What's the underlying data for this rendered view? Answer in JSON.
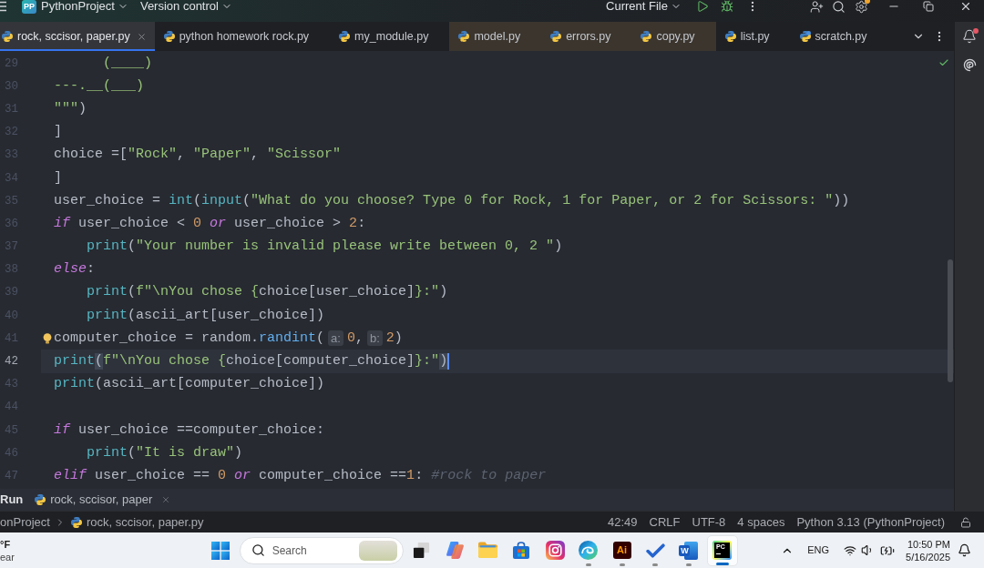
{
  "title_bar": {
    "project_badge": "PP",
    "project": "PythonProject",
    "version_control": "Version control",
    "run_configuration": "Current File",
    "settings_update": true
  },
  "tabs": [
    {
      "label": "rock, sccisor, paper.py",
      "kind": "python",
      "selected": true
    },
    {
      "label": "python homework rock.py",
      "kind": "python",
      "selected": false
    },
    {
      "label": "my_module.py",
      "kind": "python",
      "selected": false
    },
    {
      "label": "model.py",
      "kind": "python",
      "selected": false,
      "color": "#3b352e"
    },
    {
      "label": "errors.py",
      "kind": "python",
      "selected": false,
      "color": "#3b352e"
    },
    {
      "label": "copy.py",
      "kind": "python",
      "selected": false,
      "color": "#3b352e"
    },
    {
      "label": "list.py",
      "kind": "python",
      "selected": false
    },
    {
      "label": "scratch.py",
      "kind": "scratch",
      "selected": false
    }
  ],
  "side_toolbar": {
    "unread_notifications": true
  },
  "editor": {
    "lines": [
      {
        "number": "29",
        "current": false,
        "bulb": false,
        "tokens": [
          {
            "kind": "string",
            "text": "      (____)"
          }
        ]
      },
      {
        "number": "30",
        "current": false,
        "bulb": false,
        "tokens": [
          {
            "kind": "string",
            "text": "---.__(___)"
          }
        ]
      },
      {
        "number": "31",
        "current": false,
        "bulb": false,
        "tokens": [
          {
            "kind": "string",
            "text": "\"\"\""
          },
          {
            "kind": "text",
            "text": ")"
          }
        ]
      },
      {
        "number": "32",
        "current": false,
        "bulb": false,
        "tokens": [
          {
            "kind": "text",
            "text": "]"
          }
        ]
      },
      {
        "number": "33",
        "current": false,
        "bulb": false,
        "tokens": [
          {
            "kind": "text",
            "text": "choice =["
          },
          {
            "kind": "string",
            "text": "\"Rock\""
          },
          {
            "kind": "text",
            "text": ", "
          },
          {
            "kind": "string",
            "text": "\"Paper\""
          },
          {
            "kind": "text",
            "text": ", "
          },
          {
            "kind": "string",
            "text": "\"Scissor\""
          }
        ]
      },
      {
        "number": "34",
        "current": false,
        "bulb": false,
        "tokens": [
          {
            "kind": "text",
            "text": "]"
          }
        ]
      },
      {
        "number": "35",
        "current": false,
        "bulb": false,
        "tokens": [
          {
            "kind": "text",
            "text": "user_choice = "
          },
          {
            "kind": "builtin",
            "text": "int"
          },
          {
            "kind": "text",
            "text": "("
          },
          {
            "kind": "builtin",
            "text": "input"
          },
          {
            "kind": "text",
            "text": "("
          },
          {
            "kind": "string",
            "text": "\"What do you choose? Type 0 for Rock, 1 for Paper, or 2 for Scissors: \""
          },
          {
            "kind": "text",
            "text": "))"
          }
        ]
      },
      {
        "number": "36",
        "current": false,
        "bulb": false,
        "tokens": [
          {
            "kind": "keyword",
            "text": "if"
          },
          {
            "kind": "text",
            "text": " user_choice < "
          },
          {
            "kind": "number",
            "text": "0"
          },
          {
            "kind": "keyword",
            "text": " or"
          },
          {
            "kind": "text",
            "text": " user_choice > "
          },
          {
            "kind": "number",
            "text": "2"
          },
          {
            "kind": "text",
            "text": ":"
          }
        ]
      },
      {
        "number": "37",
        "current": false,
        "bulb": false,
        "tokens": [
          {
            "kind": "builtin",
            "text": "    print"
          },
          {
            "kind": "text",
            "text": "("
          },
          {
            "kind": "string",
            "text": "\"Your number is invalid please write between 0, 2 \""
          },
          {
            "kind": "text",
            "text": ")"
          }
        ]
      },
      {
        "number": "38",
        "current": false,
        "bulb": false,
        "tokens": [
          {
            "kind": "keyword",
            "text": "else"
          },
          {
            "kind": "text",
            "text": ":"
          }
        ]
      },
      {
        "number": "39",
        "current": false,
        "bulb": false,
        "tokens": [
          {
            "kind": "builtin",
            "text": "    print"
          },
          {
            "kind": "text",
            "text": "("
          },
          {
            "kind": "string",
            "text": "f\"\\nYou chose {"
          },
          {
            "kind": "text",
            "text": "choice[user_choice]"
          },
          {
            "kind": "string",
            "text": "}:\""
          },
          {
            "kind": "text",
            "text": ")"
          }
        ]
      },
      {
        "number": "40",
        "current": false,
        "bulb": false,
        "tokens": [
          {
            "kind": "builtin",
            "text": "    print"
          },
          {
            "kind": "text",
            "text": "(ascii_art[user_choice])"
          }
        ]
      },
      {
        "number": "41",
        "current": false,
        "bulb": true,
        "tokens": [
          {
            "kind": "text",
            "text": "computer_choice = random."
          },
          {
            "kind": "method",
            "text": "randint"
          },
          {
            "kind": "text",
            "text": "("
          },
          {
            "kind": "hint",
            "text": "a:"
          },
          {
            "kind": "number",
            "text": "0"
          },
          {
            "kind": "text",
            "text": ","
          },
          {
            "kind": "hint",
            "text": "b:"
          },
          {
            "kind": "number",
            "text": "2"
          },
          {
            "kind": "text",
            "text": ")"
          }
        ]
      },
      {
        "number": "42",
        "current": true,
        "bulb": false,
        "tokens": [
          {
            "kind": "builtin",
            "text": "print"
          },
          {
            "kind": "brace_match",
            "text": "("
          },
          {
            "kind": "string",
            "text": "f\"\\nYou chose {"
          },
          {
            "kind": "text",
            "text": "choice[computer_choice]"
          },
          {
            "kind": "string",
            "text": "}:\""
          },
          {
            "kind": "brace_match",
            "text": ")"
          }
        ]
      },
      {
        "number": "43",
        "current": false,
        "bulb": false,
        "tokens": [
          {
            "kind": "builtin",
            "text": "print"
          },
          {
            "kind": "text",
            "text": "(ascii_art[computer_choice])"
          }
        ]
      },
      {
        "number": "44",
        "current": false,
        "bulb": false
      },
      {
        "number": "45",
        "current": false,
        "bulb": false,
        "tokens": [
          {
            "kind": "keyword",
            "text": "if"
          },
          {
            "kind": "text",
            "text": " user_choice ==computer_choice:"
          }
        ]
      },
      {
        "number": "46",
        "current": false,
        "bulb": false,
        "tokens": [
          {
            "kind": "builtin",
            "text": "    print"
          },
          {
            "kind": "text",
            "text": "("
          },
          {
            "kind": "string",
            "text": "\"It is draw\""
          },
          {
            "kind": "text",
            "text": ")"
          }
        ]
      },
      {
        "number": "47",
        "current": false,
        "bulb": false,
        "tokens": [
          {
            "kind": "keyword",
            "text": "elif"
          },
          {
            "kind": "text",
            "text": " user_choice == "
          },
          {
            "kind": "number",
            "text": "0"
          },
          {
            "kind": "keyword",
            "text": " or"
          },
          {
            "kind": "text",
            "text": " computer_choice =="
          },
          {
            "kind": "number",
            "text": "1"
          },
          {
            "kind": "text",
            "text": ": "
          },
          {
            "kind": "comment",
            "text": "#rock to paper"
          }
        ]
      }
    ]
  },
  "run_panel": {
    "title": "Run",
    "tab": "rock, sccisor, paper"
  },
  "status_bar": {
    "breadcrumbs": [
      {
        "kind": "project",
        "label": "onProject"
      },
      {
        "kind": "python",
        "label": "rock, sccisor, paper.py"
      }
    ],
    "items": [
      "42:49",
      "CRLF",
      "UTF-8",
      "4 spaces",
      "Python 3.13 (PythonProject)"
    ]
  },
  "taskbar": {
    "weather": {
      "temperature": "°F",
      "condition": "ear"
    },
    "items": [
      {
        "kind": "start",
        "running": false,
        "selected": false
      },
      {
        "kind": "search",
        "placeholder": "Search"
      },
      {
        "kind": "task_view",
        "running": false,
        "selected": false
      },
      {
        "kind": "copilot",
        "running": false,
        "selected": false
      },
      {
        "kind": "files",
        "running": false,
        "selected": false
      },
      {
        "kind": "store",
        "running": false,
        "selected": false
      },
      {
        "kind": "instagram",
        "running": false,
        "selected": false
      },
      {
        "kind": "browser",
        "running": true,
        "selected": false
      },
      {
        "kind": "illustrator",
        "label": "Ai",
        "running": true,
        "selected": false
      },
      {
        "kind": "todo",
        "running": true,
        "selected": false
      },
      {
        "kind": "word",
        "label": "W",
        "running": true,
        "selected": false
      },
      {
        "kind": "pycharm",
        "label": "PC",
        "running": true,
        "selected": true
      }
    ],
    "tray": {
      "language": "ENG",
      "time": "10:50 PM",
      "date": "5/16/2025"
    }
  }
}
